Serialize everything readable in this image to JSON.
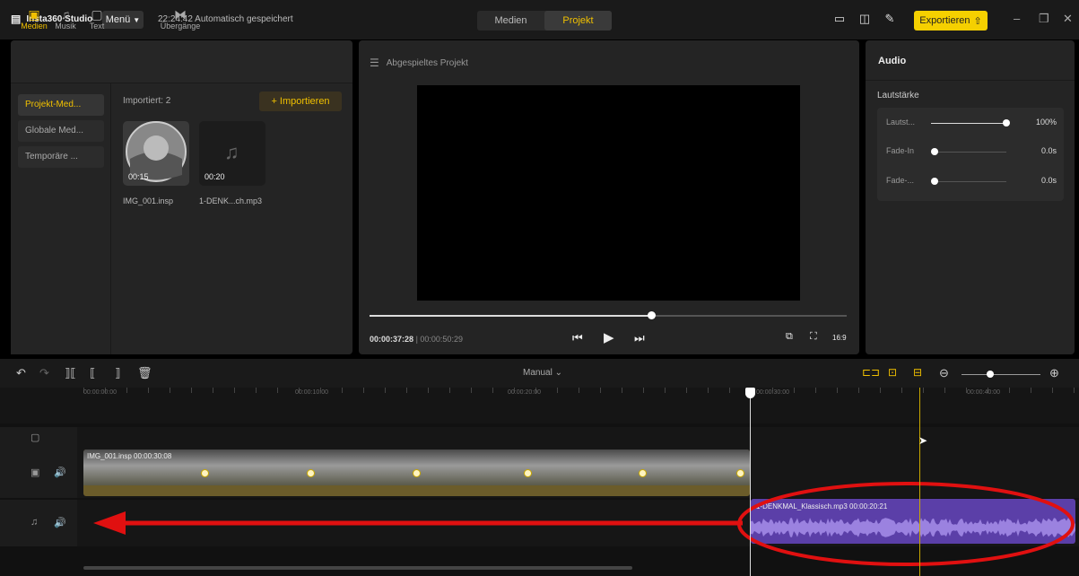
{
  "titlebar": {
    "app_name": "Insta360 Studio",
    "menu_label": "Menü",
    "autosave": "22:24:42 Automatisch gespeichert",
    "tabs": [
      "Medien",
      "Projekt"
    ],
    "export_label": "Exportieren"
  },
  "media_panel": {
    "tabs": [
      {
        "label": "Medien",
        "icon": "folder-play-icon"
      },
      {
        "label": "Musik",
        "icon": "music-note-icon"
      },
      {
        "label": "Text",
        "icon": "text-box-icon"
      },
      {
        "label": "Übergänge",
        "icon": "transition-icon"
      }
    ],
    "side_items": [
      "Projekt-Med...",
      "Globale Med...",
      "Temporäre ..."
    ],
    "imported_count": "Importiert: 2",
    "import_button": "+ Importieren",
    "files": [
      {
        "name": "IMG_001.insp",
        "duration": "00:15"
      },
      {
        "name": "1-DENK...ch.mp3",
        "duration": "00:20"
      }
    ]
  },
  "preview": {
    "title": "Abgespieltes Projekt",
    "current_time": "00:00:37:28",
    "total_time": "00:00:50:29",
    "progress": 0.59,
    "aspect": "16:9"
  },
  "audio_panel": {
    "header": "Audio",
    "section": "Lautstärke",
    "rows": [
      {
        "label": "Lautst...",
        "value": "100%",
        "level": 1.0
      },
      {
        "label": "Fade-In",
        "value": "0.0s",
        "level": 0.0
      },
      {
        "label": "Fade-...",
        "value": "0.0s",
        "level": 0.0
      }
    ]
  },
  "timeline": {
    "mode": "Manual",
    "ruler": [
      "00:00:00:00",
      "00:00:10:00",
      "00:00:20:00",
      "00:00:30:00",
      "00:00:40:00"
    ],
    "video_clip": {
      "label": "IMG_001.insp  00:00:30:08"
    },
    "audio_clip": {
      "label": "1-DENKMAL_Klassisch.mp3  00:00:20:21"
    }
  }
}
